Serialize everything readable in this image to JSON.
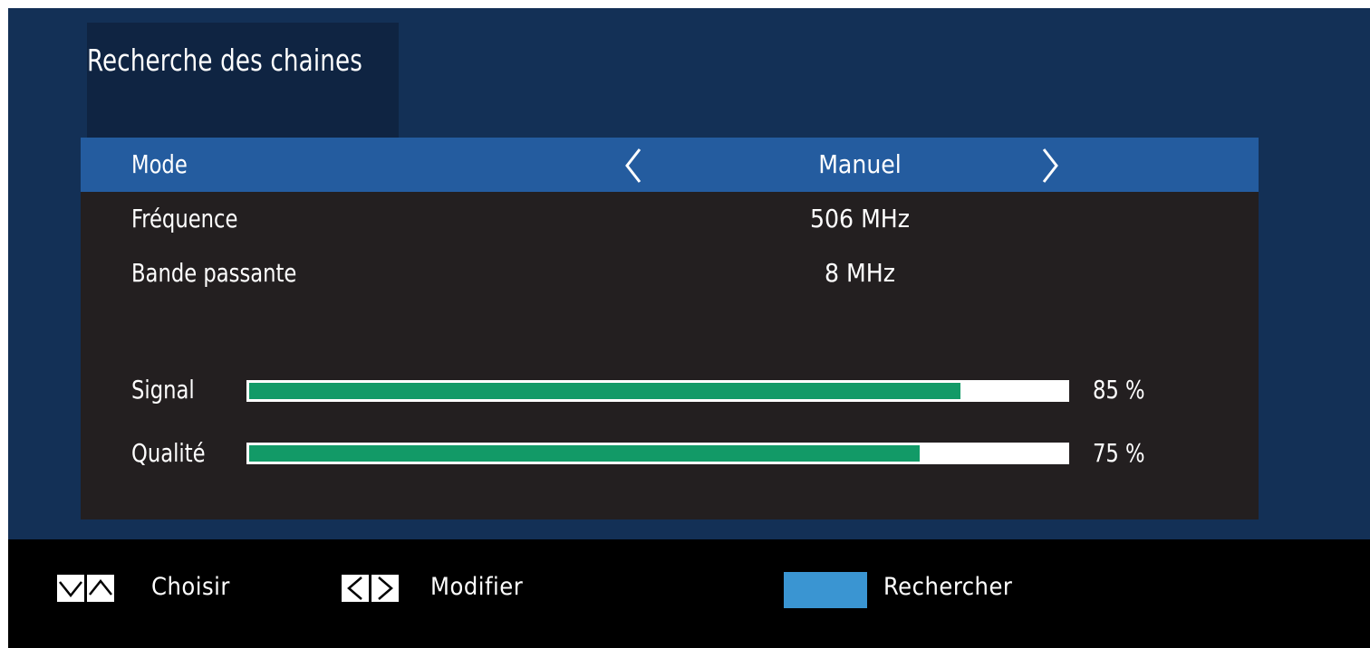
{
  "header": {
    "title": "Recherche des chaines"
  },
  "settings": {
    "mode": {
      "label": "Mode",
      "value": "Manuel"
    },
    "frequency": {
      "label": "Fréquence",
      "value": "506 MHz"
    },
    "bandwidth": {
      "label": "Bande passante",
      "value": "8 MHz"
    }
  },
  "meters": {
    "signal": {
      "label": "Signal",
      "value_text": "85 %",
      "level": 0.87
    },
    "quality": {
      "label": "Qualité",
      "value_text": "75 %",
      "level": 0.82
    }
  },
  "footer": {
    "select_hint": {
      "label": "Choisir",
      "icons": [
        "chevron-down-icon",
        "chevron-up-icon"
      ]
    },
    "modify_hint": {
      "label": "Modifier",
      "icons": [
        "chevron-left-icon",
        "chevron-right-icon"
      ]
    },
    "search_hint": {
      "label": "Rechercher",
      "key_color": "#3a95d2"
    }
  },
  "colors": {
    "background": "#133056",
    "panel": "#231f20",
    "selected_row": "#245c9f",
    "meter_fill": "#129a67",
    "meter_track": "#ffffff"
  }
}
